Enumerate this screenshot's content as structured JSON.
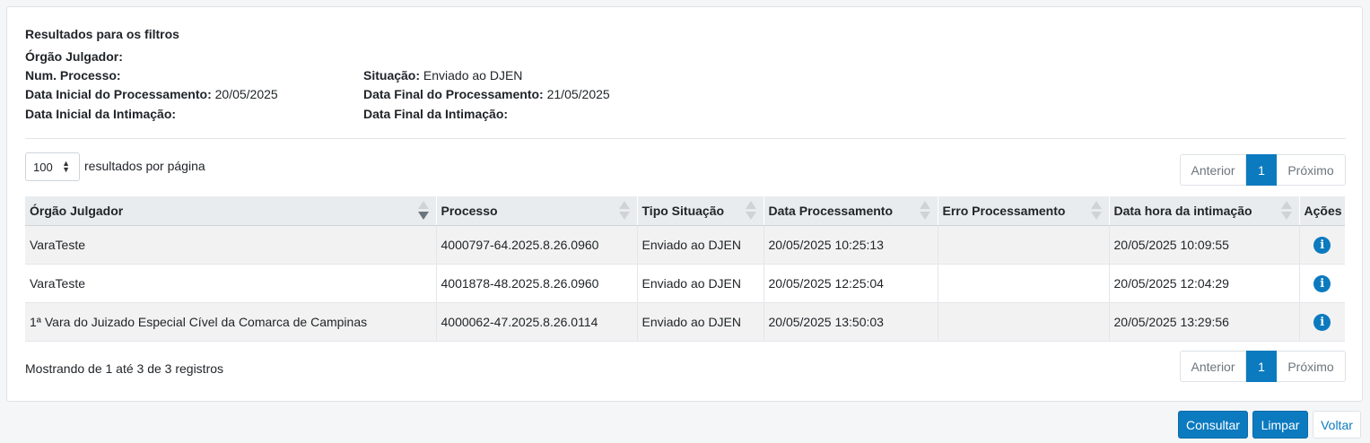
{
  "filters": {
    "title": "Resultados para os filtros",
    "orgao_label": "Órgão Julgador:",
    "orgao_value": "",
    "processo_label": "Num. Processo:",
    "processo_value": "",
    "situacao_label": "Situação:",
    "situacao_value": "Enviado ao DJEN",
    "data_ini_proc_label": "Data Inicial do Processamento:",
    "data_ini_proc_value": "20/05/2025",
    "data_fim_proc_label": "Data Final do Processamento:",
    "data_fim_proc_value": "21/05/2025",
    "data_ini_int_label": "Data Inicial da Intimação:",
    "data_ini_int_value": "",
    "data_fim_int_label": "Data Final da Intimação:",
    "data_fim_int_value": ""
  },
  "length": {
    "value": "100",
    "label": "resultados por página"
  },
  "pagination": {
    "prev": "Anterior",
    "page": "1",
    "next": "Próximo"
  },
  "table": {
    "headers": [
      "Órgão Julgador",
      "Processo",
      "Tipo Situação",
      "Data Processamento",
      "Erro Processamento",
      "Data hora da intimação",
      "Ações"
    ],
    "rows": [
      [
        "VaraTeste",
        "4000797-64.2025.8.26.0960",
        "Enviado ao DJEN",
        "20/05/2025 10:25:13",
        "",
        "20/05/2025 10:09:55"
      ],
      [
        "VaraTeste",
        "4001878-48.2025.8.26.0960",
        "Enviado ao DJEN",
        "20/05/2025 12:25:04",
        "",
        "20/05/2025 12:04:29"
      ],
      [
        "1ª Vara do Juizado Especial Cível da Comarca de Campinas",
        "4000062-47.2025.8.26.0114",
        "Enviado ao DJEN",
        "20/05/2025 13:50:03",
        "",
        "20/05/2025 13:29:56"
      ]
    ],
    "action_icon": "info-icon",
    "action_glyph": "i"
  },
  "footer": {
    "showing": "Mostrando de 1 até 3 de 3 registros"
  },
  "buttons": {
    "consultar": "Consultar",
    "limpar": "Limpar",
    "voltar": "Voltar"
  },
  "colors": {
    "primary": "#0c7abf",
    "header_bg": "#e9ecef",
    "stripe": "#f2f2f2"
  }
}
